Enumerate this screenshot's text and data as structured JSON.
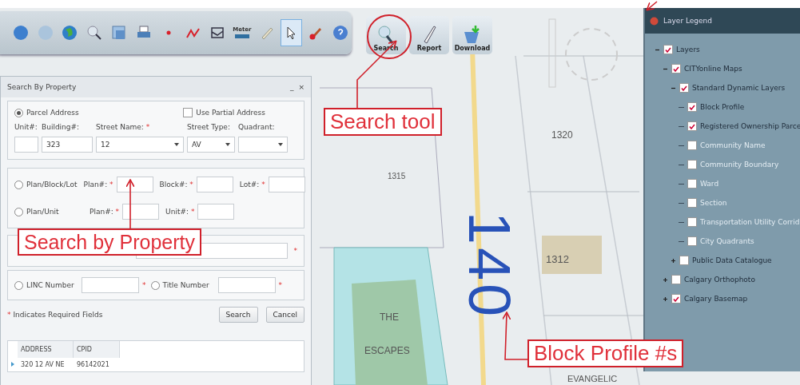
{
  "toolbar": {
    "tools": [
      {
        "kind": "back",
        "selected": false
      },
      {
        "kind": "forward",
        "selected": false
      },
      {
        "kind": "globe",
        "selected": false
      },
      {
        "kind": "identify",
        "selected": false
      },
      {
        "kind": "layers",
        "selected": false
      },
      {
        "kind": "print",
        "selected": false
      },
      {
        "kind": "point",
        "selected": false
      },
      {
        "kind": "line",
        "selected": false
      },
      {
        "kind": "polygon",
        "selected": false
      },
      {
        "kind": "meter",
        "label": "Meter",
        "selected": false
      },
      {
        "kind": "pencil",
        "selected": false
      },
      {
        "kind": "pointer",
        "selected": true
      },
      {
        "kind": "eraser",
        "selected": false
      },
      {
        "kind": "help",
        "selected": false
      }
    ]
  },
  "actions": [
    {
      "kind": "search",
      "label": "Search"
    },
    {
      "kind": "report",
      "label": "Report"
    },
    {
      "kind": "download",
      "label": "Download"
    }
  ],
  "search_dialog": {
    "title": "Search By Property",
    "minimize": "_",
    "close": "×",
    "address": {
      "label": "Parcel Address",
      "selected": true,
      "partial": {
        "label": "Use Partial Address",
        "checked": false
      },
      "fields": [
        {
          "label": "Unit#:",
          "required": false,
          "kind": "text"
        },
        {
          "label": "Building#:",
          "value": "323",
          "required": false,
          "kind": "text"
        },
        {
          "label": "Street Name:",
          "value": "12",
          "required": true,
          "kind": "combo"
        },
        {
          "label": "Street Type:",
          "value": "AV",
          "required": false,
          "kind": "combo"
        },
        {
          "label": "Quadrant:",
          "required": false,
          "kind": "combo"
        }
      ]
    },
    "options": [
      {
        "label": "Plan/Block/Lot",
        "selected": false,
        "fields": [
          {
            "label": "Plan#:",
            "required": true
          },
          {
            "label": "Block#:",
            "required": true
          },
          {
            "label": "Lot#:",
            "required": true
          }
        ]
      },
      {
        "label": "Plan/Unit",
        "selected": false,
        "fields": [
          {
            "label": "Plan#:",
            "required": true
          },
          {
            "label": "Unit#:",
            "required": true
          }
        ]
      }
    ],
    "covered_row": {
      "required": true
    },
    "numbers": [
      {
        "label": "LINC Number",
        "selected": false,
        "required": true
      },
      {
        "label": "Title Number",
        "selected": false,
        "required": true
      }
    ],
    "note": {
      "mark": "*",
      "text": "Indicates Required Fields"
    },
    "buttons": [
      "Search",
      "Cancel"
    ],
    "results": {
      "columns": [
        "ADDRESS",
        "CPID"
      ],
      "rows": [
        [
          "320 12 AV NE",
          "96142021"
        ]
      ]
    }
  },
  "map": {
    "labels": [
      {
        "kind": "parcel",
        "text": "1315"
      },
      {
        "kind": "parcel",
        "text": "1320"
      },
      {
        "kind": "building",
        "text": "1312"
      },
      {
        "kind": "block",
        "text": "140"
      },
      {
        "kind": "park",
        "text": "THE"
      },
      {
        "kind": "park",
        "text": "ESCAPES"
      },
      {
        "kind": "road",
        "text": "EVANGELIC"
      }
    ]
  },
  "legend": {
    "title": "Layer Legend",
    "items": [
      {
        "label": "Layers",
        "checked": true,
        "disabled": false,
        "expanded": true,
        "children": [
          {
            "label": "CITYonline Maps",
            "checked": true,
            "disabled": false,
            "expanded": true,
            "children": [
              {
                "label": "Standard Dynamic Layers",
                "checked": true,
                "disabled": false,
                "expanded": true,
                "children": [
                  {
                    "label": "Block Profile",
                    "checked": true,
                    "disabled": false
                  },
                  {
                    "label": "Registered Ownership Parce",
                    "checked": true,
                    "disabled": false
                  },
                  {
                    "label": "Community Name",
                    "checked": false,
                    "disabled": true
                  },
                  {
                    "label": "Community Boundary",
                    "checked": false,
                    "disabled": true
                  },
                  {
                    "label": "Ward",
                    "checked": false,
                    "disabled": true
                  },
                  {
                    "label": "Section",
                    "checked": false,
                    "disabled": true
                  },
                  {
                    "label": "Transportation Utility Corrid",
                    "checked": false,
                    "disabled": true
                  },
                  {
                    "label": "City Quadrants",
                    "checked": false,
                    "disabled": true
                  }
                ]
              },
              {
                "label": "Public Data Catalogue",
                "checked": false,
                "disabled": false,
                "expanded": false
              }
            ]
          },
          {
            "label": "Calgary Orthophoto",
            "checked": false,
            "disabled": false,
            "expanded": false
          },
          {
            "label": "Calgary Basemap",
            "checked": true,
            "disabled": false,
            "expanded": false
          }
        ]
      }
    ]
  },
  "callouts": [
    {
      "kind": "search",
      "text": "Search tool"
    },
    {
      "kind": "property",
      "text": "Search by Property"
    },
    {
      "kind": "block",
      "text": "Block Profile #s"
    }
  ]
}
